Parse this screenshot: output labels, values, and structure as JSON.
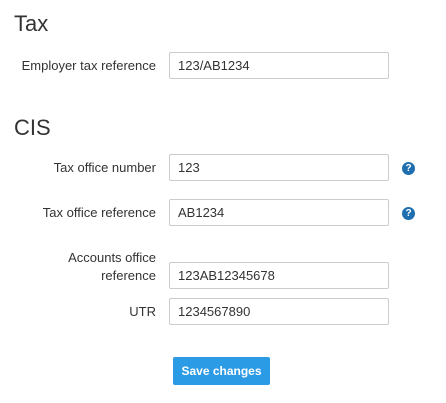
{
  "tax": {
    "title": "Tax",
    "employer_ref_label": "Employer tax reference",
    "employer_ref_value": "123/AB1234"
  },
  "cis": {
    "title": "CIS",
    "office_number_label": "Tax office number",
    "office_number_value": "123",
    "office_reference_label": "Tax office reference",
    "office_reference_value": "AB1234",
    "accounts_office_label_line1": "Accounts office",
    "accounts_office_label_line2": "reference",
    "accounts_office_value": "123AB12345678",
    "utr_label": "UTR",
    "utr_value": "1234567890",
    "help_icon_glyph": "?",
    "help_icon_name": "question-circle-icon"
  },
  "actions": {
    "save_label": "Save changes"
  },
  "colors": {
    "accent": "#2c9be6",
    "help_icon": "#1f6fb0"
  }
}
